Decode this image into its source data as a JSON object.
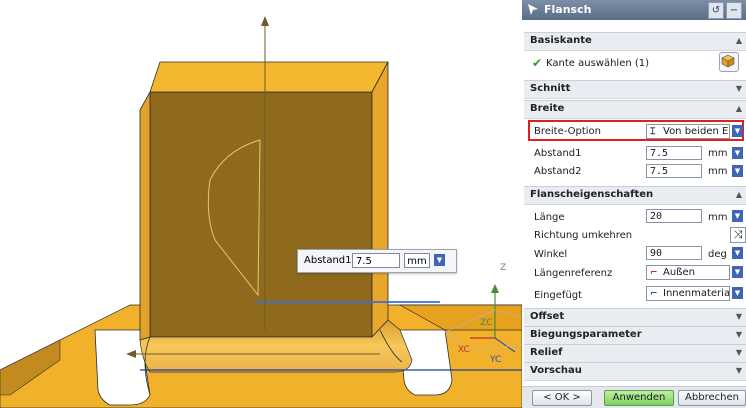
{
  "dialog": {
    "title": "Flansch",
    "reset_icon": "reset-icon",
    "collapse_icon": "minus-icon",
    "sections": {
      "basiskante": "Basiskante",
      "schnitt": "Schnitt",
      "breite": "Breite",
      "flanscheigenschaften": "Flanscheigenschaften",
      "offset": "Offset",
      "biegungsparameter": "Biegungsparameter",
      "relief": "Relief",
      "vorschau": "Vorschau"
    },
    "edge_select": {
      "label": "Kante auswählen (1)",
      "status_color": "#2e9a2a",
      "icon": "cube-select-icon"
    },
    "breite": {
      "option_label": "Breite-Option",
      "option_value": "Von beiden Enden",
      "option_icon": "width-both-ends-icon",
      "abstand1_label": "Abstand1",
      "abstand1_value": "7.5",
      "abstand1_unit": "mm",
      "abstand2_label": "Abstand2",
      "abstand2_value": "7.5",
      "abstand2_unit": "mm",
      "highlight_color": "#e02020"
    },
    "flansch": {
      "laenge_label": "Länge",
      "laenge_value": "20",
      "laenge_unit": "mm",
      "richtung_label": "Richtung umkehren",
      "winkel_label": "Winkel",
      "winkel_value": "90",
      "winkel_unit": "deg",
      "laengenreferenz_label": "Längenreferenz",
      "laengenreferenz_value": "Außen",
      "eingefuegt_label": "Eingefügt",
      "eingefuegt_value": "Innenmaterial"
    },
    "buttons": {
      "ok": "< OK >",
      "apply": "Anwenden",
      "cancel": "Abbrechen"
    }
  },
  "viewport": {
    "popup": {
      "label": "Abstand1",
      "value": "7.5",
      "unit": "mm"
    },
    "axes": {
      "z": "Z",
      "zc": "ZC",
      "xc": "XC",
      "yc": "YC"
    },
    "part_color": "#f2b12a",
    "part_shadow_color": "#8f6a1c",
    "edge_color": "#1f3f8f"
  }
}
